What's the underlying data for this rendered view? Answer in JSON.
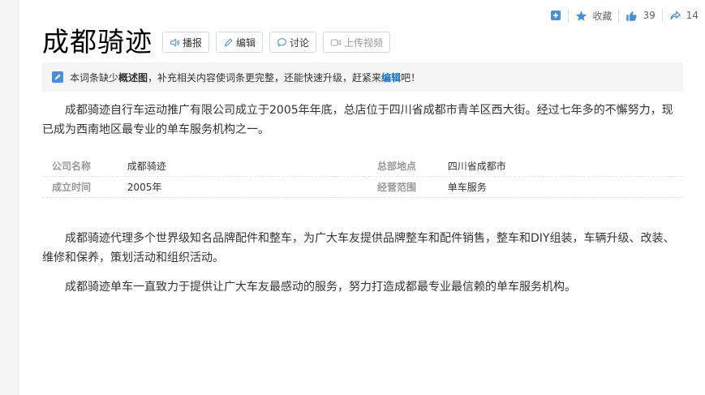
{
  "top_actions": {
    "collect_label": "收藏",
    "like_count": "39",
    "share_count": "14"
  },
  "title": "成都骑迹",
  "tools": {
    "play": "播报",
    "edit": "编辑",
    "discuss": "讨论",
    "upload_video": "上传视频"
  },
  "notice": {
    "pre": "本词条缺少",
    "bold": "概述图",
    "mid": "，补充相关内容使词条更完整，还能快速升级，赶紧来",
    "link": "编辑",
    "post": "吧！"
  },
  "intro": "成都骑迹自行车运动推广有限公司成立于2005年年底，总店位于四川省成都市青羊区西大街。经过七年多的不懈努力，现已成为西南地区最专业的单车服务机构之一。",
  "info": [
    {
      "k1": "公司名称",
      "v1": "成都骑迹",
      "k2": "总部地点",
      "v2": "四川省成都市"
    },
    {
      "k1": "成立时间",
      "v1": "2005年",
      "k2": "经营范围",
      "v2": "单车服务"
    }
  ],
  "body": [
    "成都骑迹代理多个世界级知名品牌配件和整车，为广大车友提供品牌整车和配件销售，整车和DIY组装，车辆升级、改装、维修和保养，策划活动和组织活动。",
    "成都骑迹单车一直致力于提供让广大车友最感动的服务，努力打造成都最专业最信赖的单车服务机构。"
  ],
  "colors": {
    "accent": "#136ec2",
    "icon": "#4a90d9"
  }
}
